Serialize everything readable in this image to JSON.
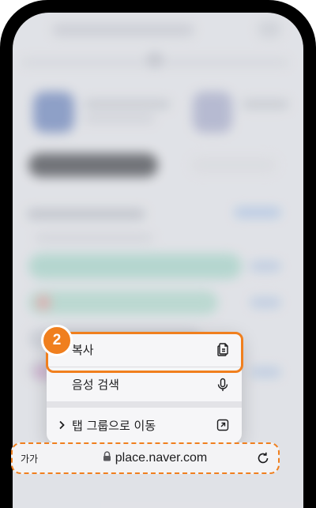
{
  "context_menu": {
    "step_badge": "2",
    "items": [
      {
        "label": "복사",
        "icon": "copy-icon"
      },
      {
        "label": "음성 검색",
        "icon": "microphone-icon"
      },
      {
        "label": "탭 그룹으로 이동",
        "icon": "move-to-tab-group-icon",
        "prefix_icon": "chevron-right-icon"
      }
    ]
  },
  "address_bar": {
    "text_size_label": "가가",
    "url": "place.naver.com",
    "lock_icon": "lock-icon",
    "reload_icon": "reload-icon"
  },
  "colors": {
    "accent": "#f07f1e",
    "menu_background": "#f6f6f8",
    "device_frame": "#000000"
  }
}
